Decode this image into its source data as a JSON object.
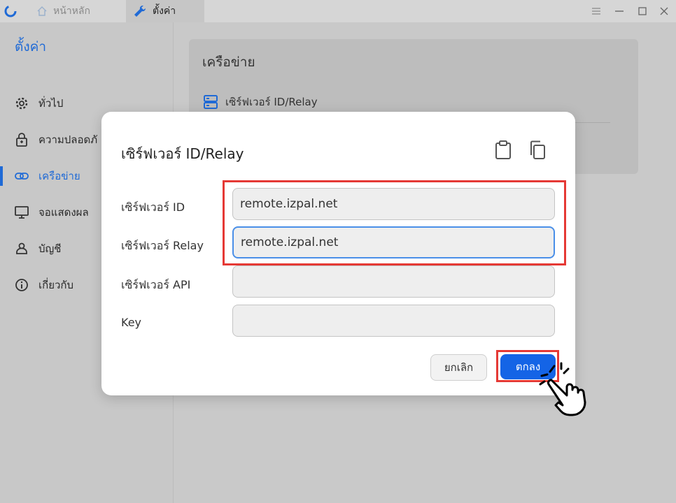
{
  "titlebar": {
    "tabs": [
      {
        "label": "หน้าหลัก"
      },
      {
        "label": "ตั้งค่า"
      }
    ]
  },
  "sidebar": {
    "title": "ตั้งค่า",
    "items": [
      {
        "label": "ทั่วไป",
        "icon": "gear-icon"
      },
      {
        "label": "ความปลอดภั",
        "icon": "lock-icon"
      },
      {
        "label": "เครือข่าย",
        "icon": "link-icon",
        "active": true
      },
      {
        "label": "จอแสดงผล",
        "icon": "monitor-icon"
      },
      {
        "label": "บัญชี",
        "icon": "person-icon"
      },
      {
        "label": "เกี่ยวกับ",
        "icon": "info-icon"
      }
    ]
  },
  "main": {
    "card_title": "เครือข่าย",
    "card_row_label": "เซิร์ฟเวอร์ ID/Relay"
  },
  "dialog": {
    "title": "เซิร์ฟเวอร์ ID/Relay",
    "fields": [
      {
        "label": "เซิร์ฟเวอร์ ID",
        "value": "remote.izpal.net"
      },
      {
        "label": "เซิร์ฟเวอร์ Relay",
        "value": "remote.izpal.net"
      },
      {
        "label": "เซิร์ฟเวอร์ API",
        "value": ""
      },
      {
        "label": "Key",
        "value": ""
      }
    ],
    "cancel_label": "ยกเลิก",
    "ok_label": "ตกลง"
  },
  "colors": {
    "accent": "#1f6ad6",
    "ok_button": "#1464e6",
    "highlight": "#e53935"
  }
}
